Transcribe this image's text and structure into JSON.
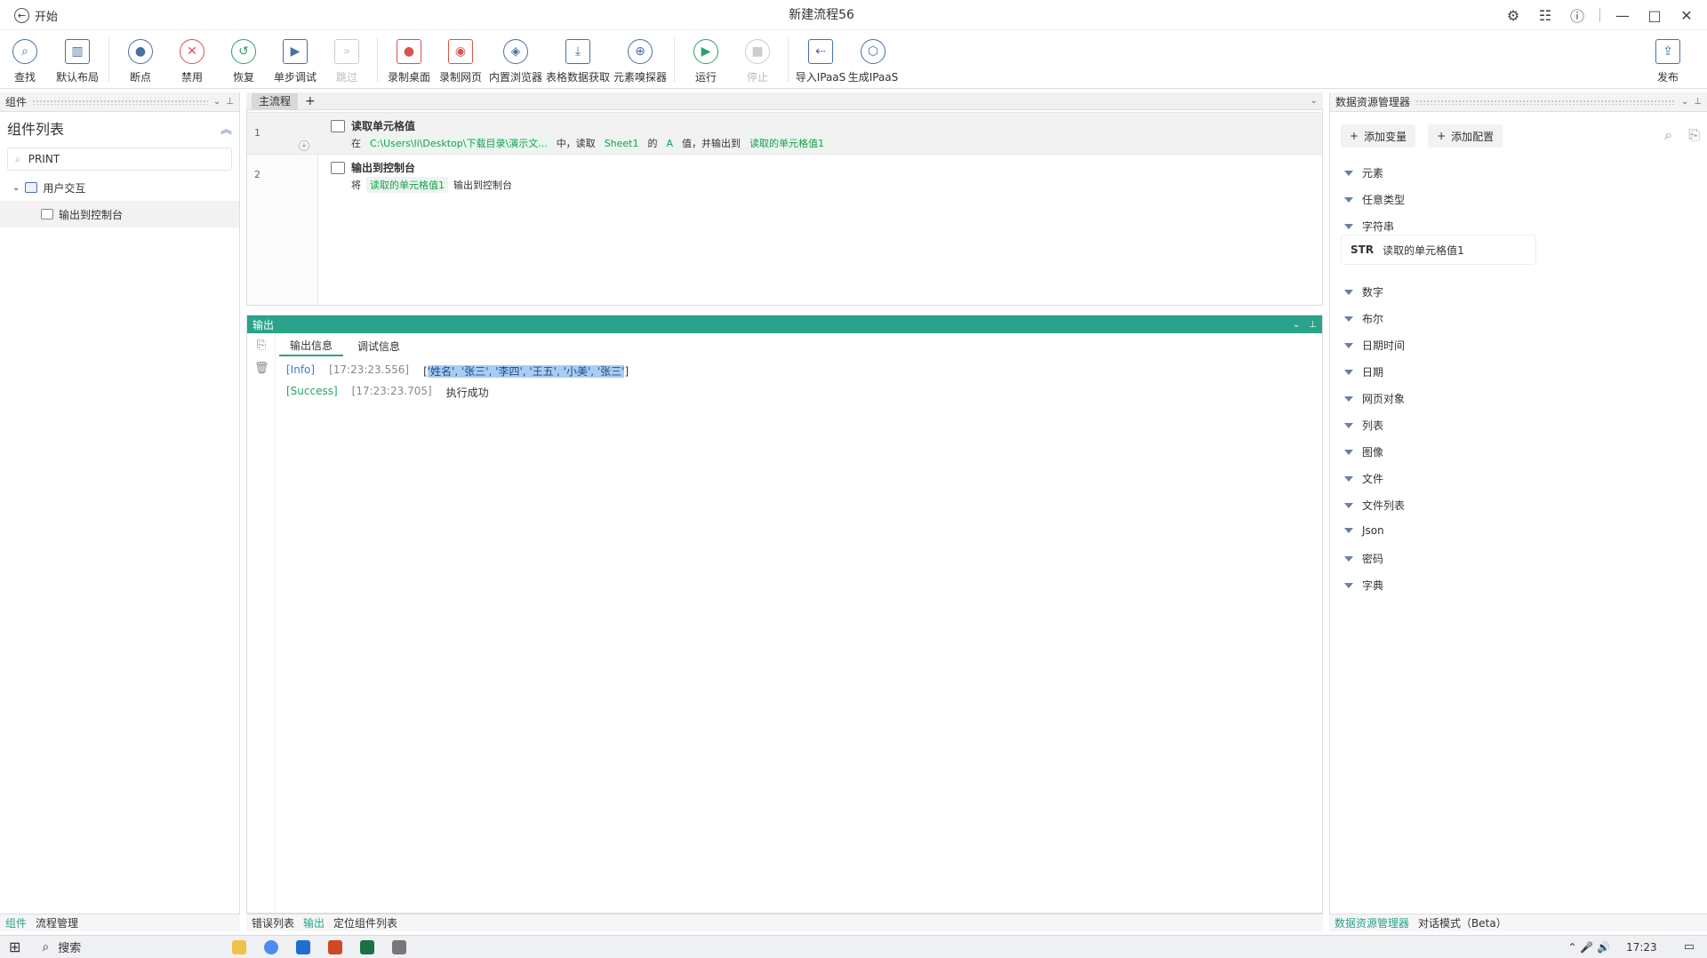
{
  "titlebar": {
    "back_label": "开始",
    "title": "新建流程56"
  },
  "toolbar": {
    "items": [
      {
        "label": "查找",
        "icon": "search-icon"
      },
      {
        "label": "默认布局",
        "icon": "layout-icon"
      },
      {
        "label": "断点",
        "icon": "breakpoint-icon"
      },
      {
        "label": "禁用",
        "icon": "disable-icon"
      },
      {
        "label": "恢复",
        "icon": "restore-icon"
      },
      {
        "label": "单步调试",
        "icon": "step-debug-icon"
      },
      {
        "label": "跳过",
        "icon": "skip-icon"
      },
      {
        "label": "录制桌面",
        "icon": "record-desktop-icon"
      },
      {
        "label": "录制网页",
        "icon": "record-web-icon"
      },
      {
        "label": "内置浏览器",
        "icon": "browser-icon"
      },
      {
        "label": "表格数据获取",
        "icon": "table-data-icon"
      },
      {
        "label": "元素嗅探器",
        "icon": "element-sniffer-icon"
      },
      {
        "label": "运行",
        "icon": "run-icon"
      },
      {
        "label": "停止",
        "icon": "stop-icon"
      },
      {
        "label": "导入IPaaS",
        "icon": "import-ipaas-icon"
      },
      {
        "label": "生成IPaaS",
        "icon": "generate-ipaas-icon"
      },
      {
        "label": "发布",
        "icon": "publish-icon"
      }
    ]
  },
  "left_panel": {
    "header": "组件",
    "title": "组件列表",
    "search_value": "PRINT",
    "tree": {
      "group": "用户交互",
      "item": "输出到控制台"
    },
    "tabs": [
      "组件",
      "流程管理"
    ]
  },
  "flow": {
    "tab": "主流程",
    "add_tab": "+",
    "steps": [
      {
        "line": "1",
        "title": "读取单元格值",
        "desc": [
          {
            "t": "在"
          },
          {
            "chip": "C:\\Users\\li\\Desktop\\下载目录\\演示文..."
          },
          {
            "t": "中，读取"
          },
          {
            "chip": "Sheet1"
          },
          {
            "t": "的"
          },
          {
            "chip": "A"
          },
          {
            "t": "值，并输出到"
          },
          {
            "chip": "读取的单元格值1"
          }
        ]
      },
      {
        "line": "2",
        "title": "输出到控制台",
        "desc": [
          {
            "t": "将"
          },
          {
            "chip": "读取的单元格值1"
          },
          {
            "t": "输出到控制台"
          }
        ]
      }
    ]
  },
  "output": {
    "header": "输出",
    "tabs": [
      "输出信息",
      "调试信息"
    ],
    "logs": [
      {
        "level": "[Info]",
        "time": "[17:23:23.556]",
        "msg_pre": "[",
        "msg_hl": "'姓名', '张三', '李四', '王五', '小美', '张三'",
        "msg_post": "]"
      },
      {
        "level": "[Success]",
        "time": "[17:23:23.705]",
        "msg_pre": "执行成功",
        "msg_hl": "",
        "msg_post": ""
      }
    ]
  },
  "bottom_center_tabs": [
    "错误列表",
    "输出",
    "定位组件列表"
  ],
  "right_panel": {
    "header": "数据资源管理器",
    "add_variable": "添加变量",
    "add_config": "添加配置",
    "categories": [
      "元素",
      "任意类型",
      "字符串",
      "数字",
      "布尔",
      "日期时间",
      "日期",
      "网页对象",
      "列表",
      "图像",
      "文件",
      "文件列表",
      "Json",
      "密码",
      "字典"
    ],
    "string_var": {
      "type": "STR",
      "name": "读取的单元格值1"
    },
    "tabs": [
      "数据资源管理器",
      "对话模式（Beta）"
    ]
  },
  "taskbar": {
    "search": "搜索",
    "time": "17:23"
  },
  "colors": {
    "accent": "#2aa38b",
    "chip_text": "#1d9b4e",
    "info": "#3a7bd5",
    "success": "#29a36a"
  }
}
